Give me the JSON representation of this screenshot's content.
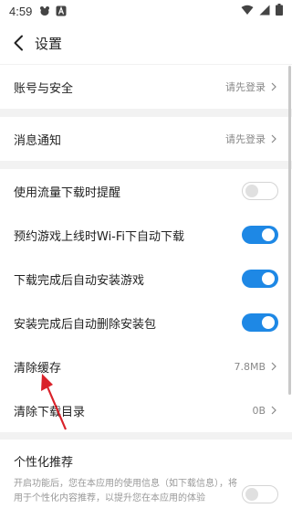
{
  "status_bar": {
    "time": "4:59"
  },
  "header": {
    "title": "设置"
  },
  "account": {
    "label": "账号与安全",
    "value": "请先登录"
  },
  "notify": {
    "label": "消息通知",
    "value": "请先登录"
  },
  "settings": [
    {
      "label": "使用流量下载时提醒",
      "on": false
    },
    {
      "label": "预约游戏上线时Wi-Fi下自动下载",
      "on": true
    },
    {
      "label": "下载完成后自动安装游戏",
      "on": true
    },
    {
      "label": "安装完成后自动删除安装包",
      "on": true
    }
  ],
  "cache": {
    "label": "清除缓存",
    "value": "7.8MB"
  },
  "download_dir": {
    "label": "清除下载目录",
    "value": "0B"
  },
  "personal": {
    "title": "个性化推荐",
    "desc": "开启功能后，您在本应用的使用信息（如下载信息），将用于个性化内容推荐，以提升您在本应用的体验",
    "on": false
  },
  "colors": {
    "accent": "#1e88e5",
    "annotation": "#d9222a"
  }
}
